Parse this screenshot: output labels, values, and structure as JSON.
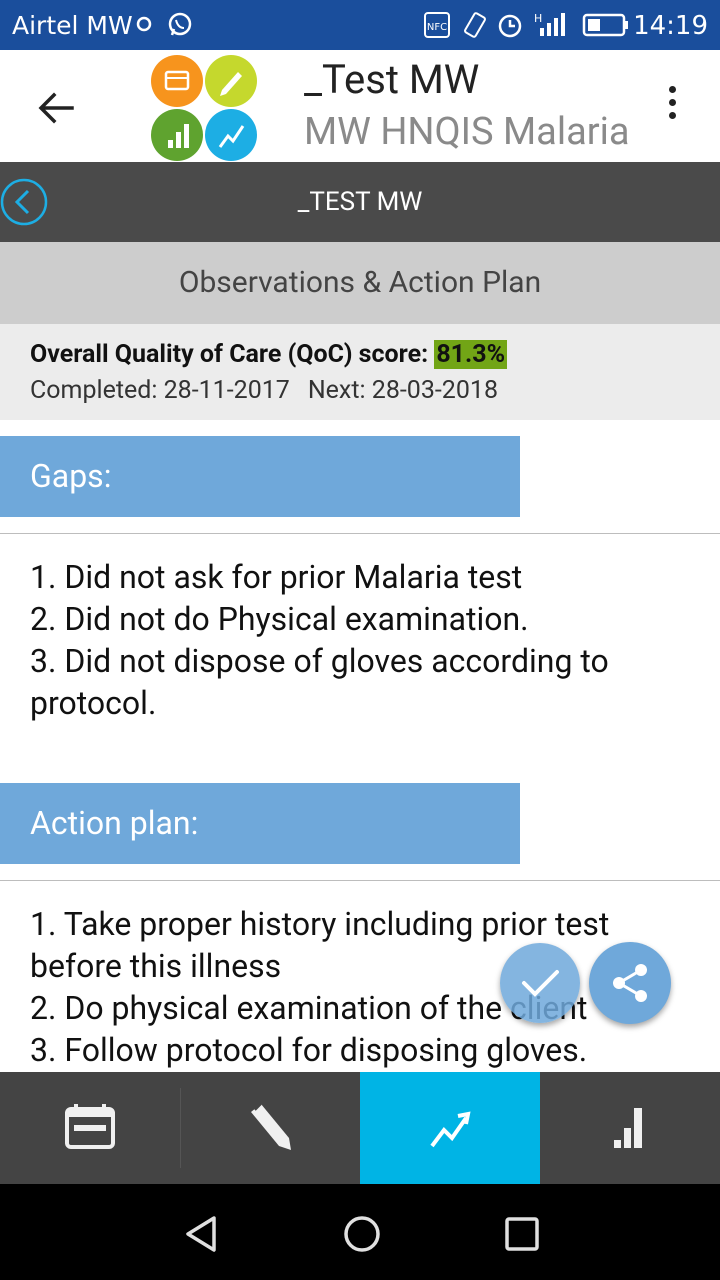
{
  "status_bar": {
    "carrier": "Airtel MW",
    "time": "14:19",
    "icons": [
      "location-icon",
      "whatsapp-icon",
      "nfc-icon",
      "vibrate-icon",
      "alarm-icon",
      "signal-icon",
      "battery-icon"
    ]
  },
  "app_bar": {
    "title": "_Test MW",
    "subtitle": "MW HNQIS Malaria",
    "logo_colors": [
      "#f7941d",
      "#c5d82d",
      "#5fa32f",
      "#1daee4"
    ]
  },
  "subheader": {
    "title": "_TEST MW"
  },
  "section": {
    "title": "Observations & Action Plan"
  },
  "score": {
    "label": "Overall Quality of Care (QoC) score: ",
    "value": "81.3%",
    "completed": "Completed: 28-11-2017",
    "next": "Next: 28-03-2018"
  },
  "gaps": {
    "header": "Gaps:",
    "lines": [
      "1. Did not ask for prior Malaria test",
      "2. Did not do Physical examination.",
      "3. Did not dispose of gloves according to protocol."
    ]
  },
  "action_plan": {
    "header": "Action plan:",
    "lines": [
      "1. Take proper history including prior test before this illness",
      "2. Do physical examination of the client",
      "3. Follow protocol for disposing gloves."
    ]
  },
  "bottom_tabs": [
    {
      "name": "calendar-tab",
      "icon": "calendar-icon",
      "active": false
    },
    {
      "name": "edit-tab",
      "icon": "pencil-icon",
      "active": false
    },
    {
      "name": "improve-tab",
      "icon": "trend-up-icon",
      "active": true
    },
    {
      "name": "stats-tab",
      "icon": "bar-chart-icon",
      "active": false
    }
  ],
  "colors": {
    "status_bar": "#1a4e9c",
    "accent": "#00b4e5",
    "tab_header": "#6fa8da",
    "score_highlight": "#72a516"
  }
}
